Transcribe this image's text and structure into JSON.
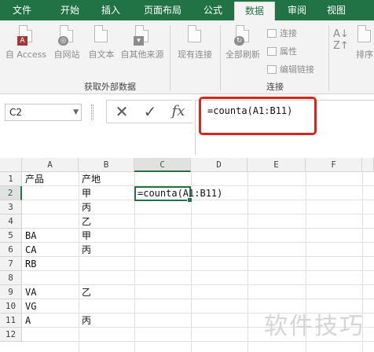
{
  "ribbon_tabs": {
    "file": "文件",
    "home": "开始",
    "insert": "插入",
    "page_layout": "页面布局",
    "formulas": "公式",
    "data": "数据",
    "review": "审阅",
    "view": "视图"
  },
  "ribbon": {
    "get_external": {
      "from_access": "自 Access",
      "from_web": "自网站",
      "from_text": "自文本",
      "from_other": "自其他来源",
      "label": "获取外部数据"
    },
    "existing_connections": "现有连接",
    "connections": {
      "refresh_all": "全部刷新",
      "connections": "连接",
      "properties": "属性",
      "edit_links": "编辑链接",
      "label": "连接"
    },
    "sort_partial": "排序"
  },
  "formula_bar": {
    "name_box": "C2",
    "formula": "=counta(A1:B11)",
    "cancel_glyph": "✕",
    "enter_glyph": "✓",
    "fx_glyph": "fx"
  },
  "sheet": {
    "columns": [
      "A",
      "B",
      "C",
      "D",
      "E",
      "F"
    ],
    "rows": [
      "1",
      "2",
      "3",
      "4",
      "5",
      "6",
      "7",
      "8",
      "9",
      "10",
      "11",
      "12"
    ],
    "cells": {
      "A1": "产品",
      "B1": "产地",
      "B2": "甲",
      "C2": "=counta(A1:B11)",
      "B3": "丙",
      "B4": "乙",
      "A5": "BA",
      "B5": "甲",
      "A6": "CA",
      "B6": "丙",
      "A7": "RB",
      "A9": "VA",
      "B9": "乙",
      "A10": "VG",
      "A11": "A",
      "B11": "丙"
    }
  },
  "watermark": "软件技巧",
  "colors": {
    "accent": "#217346",
    "highlight_box": "#d9251c"
  }
}
